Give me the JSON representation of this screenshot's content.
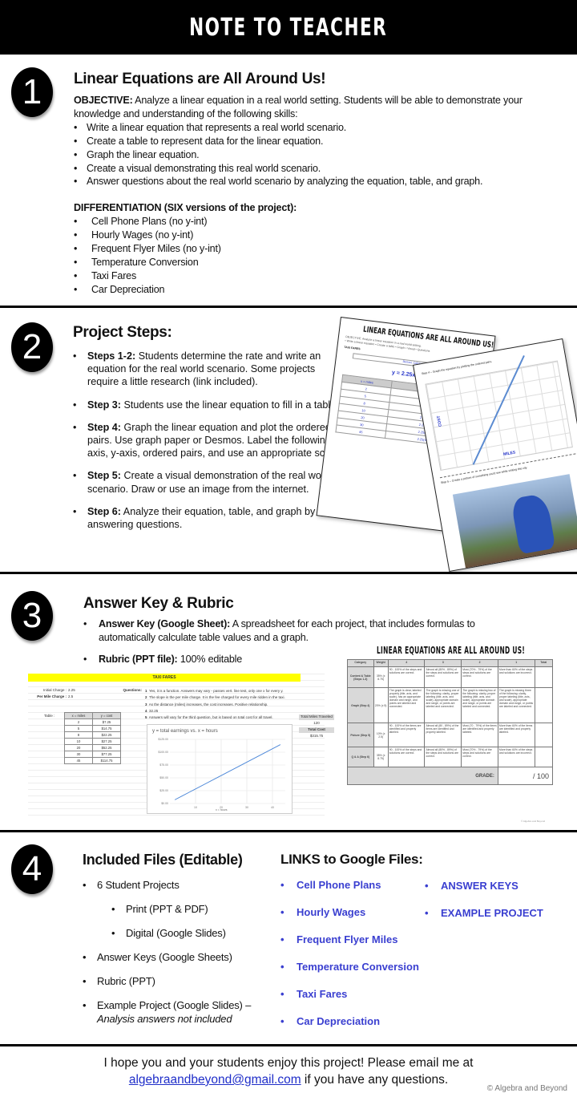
{
  "banner": {
    "title": "NOTE TO TEACHER"
  },
  "section1": {
    "number": "1",
    "title": "Linear Equations are All Around Us!",
    "objective_label": "OBJECTIVE:",
    "objective_text": " Analyze a linear equation in a real world setting. Students will be able to demonstrate your knowledge and understanding of the following skills:",
    "skills": [
      "Write a linear equation that represents a real world scenario.",
      "Create a table to represent data for the linear equation.",
      "Graph the linear equation.",
      "Create a visual demonstrating this real world scenario.",
      "Answer questions about the real world scenario by analyzing the equation, table, and graph."
    ],
    "differentiation_label": "DIFFERENTIATION (SIX versions of the project):",
    "versions": [
      "Cell Phone Plans (no y-int)",
      "Hourly Wages (no y-int)",
      "Frequent Flyer Miles (no y-int)",
      "Temperature Conversion",
      "Taxi Fares",
      "Car Depreciation"
    ]
  },
  "section2": {
    "number": "2",
    "title": "Project Steps:",
    "steps": [
      {
        "label": "Steps 1-2:",
        "text": " Students determine the rate and write an equation for the real world scenario. Some projects require a little research (link included)."
      },
      {
        "label": "Step 3:",
        "text": " Students use the linear equation to fill in a table."
      },
      {
        "label": "Step 4:",
        "text": " Graph the linear equation and plot the ordered pairs. Use graph paper or Desmos. Label the following: x-axis, y-axis, ordered pairs, and use an appropriate scale."
      },
      {
        "label": "Step 5:",
        "text": " Create a visual demonstration of the real world scenario. Draw or use an image from the internet."
      },
      {
        "label": "Step 6:",
        "text": " Analyze their equation, table, and graph by answering questions."
      }
    ],
    "preview": {
      "page1_title": "LINEAR EQUATIONS ARE ALL AROUND US!",
      "page1_subtitle": "TAXI FARES",
      "page1_city": "Denver, Colorado",
      "page1_equation": "y = 2.25x + 2.50",
      "page1_table_header": [
        "x = miles",
        "Linear Equation"
      ],
      "page1_table_rows": [
        [
          "2",
          "2.25(2) + 2.50"
        ],
        [
          "5",
          "2.25(5) + 2.50"
        ],
        [
          "8",
          "2.25(8) + 2.50"
        ],
        [
          "10",
          "2.25(10) + 2.50"
        ],
        [
          "20",
          "2.25(20) + 2.50"
        ],
        [
          "30",
          "2.25(30) + 2.50"
        ],
        [
          "45",
          "2.25(45) + 2.50"
        ]
      ],
      "page2_graph_step": "Step 4 – Graph the equation by plotting the ordered pairs.",
      "page2_xlabel": "MILES",
      "page2_ylabel": "COST",
      "page2_photo_step": "Step 5 – Create a picture of something you'd see while visiting this city."
    }
  },
  "section3": {
    "number": "3",
    "title": "Answer Key & Rubric",
    "items": [
      {
        "label": "Answer Key (Google Sheet):",
        "text": " A spreadsheet for each project, that includes formulas to automatically calculate table values and a graph."
      },
      {
        "label": "Rubric (PPT file):",
        "text": " 100% editable"
      }
    ],
    "sheet": {
      "title": "TAXI FARES",
      "initial_charge_label": "Initial Charge :",
      "initial_charge": "2.25",
      "per_mile_label": "Per Mile Charge :",
      "per_mile": "2.5",
      "table_label": "Table :",
      "table_header": [
        "x = miles",
        "y = cost"
      ],
      "table_rows": [
        [
          "2",
          "$7.25"
        ],
        [
          "5",
          "$14.75"
        ],
        [
          "8",
          "$22.25"
        ],
        [
          "10",
          "$27.25"
        ],
        [
          "20",
          "$52.25"
        ],
        [
          "30",
          "$77.25"
        ],
        [
          "45",
          "$114.75"
        ]
      ],
      "questions_label": "Questions:",
      "answers": [
        {
          "n": "1",
          "text": "Yes, it is a function. Answers may vary - passes vert. line test, only one x for every y."
        },
        {
          "n": "2",
          "text": "The slope is the per mile charge. It is the fee charged for every mile ridden in the taxi."
        },
        {
          "n": "3",
          "text": "As the distance (miles) increases, the cost increases. Positive relationship."
        },
        {
          "n": "4",
          "text": "32.25"
        },
        {
          "n": "5",
          "text": "Answers will vary for the third question, but is based on total cost for all travel."
        }
      ],
      "total_miles_label": "Total Miles Traveled",
      "total_miles": "120",
      "total_cost_label": "Total Cost",
      "total_cost": "$315.75",
      "chart_title": "y = total earnings vs. x = hours",
      "chart_xlabel": "x = hours",
      "chart_ylabel": "y = total earnings",
      "chart_yticks": [
        "$0.00",
        "$25.00",
        "$50.00",
        "$75.00",
        "$100.00",
        "$125.00"
      ],
      "chart_xticks": [
        "10",
        "20",
        "30",
        "40"
      ]
    },
    "rubric": {
      "title": "LINEAR EQUATIONS ARE ALL AROUND US!",
      "headers": [
        "Category",
        "Weight",
        "4",
        "3",
        "2",
        "1",
        "Total"
      ],
      "rows": [
        {
          "category": "Content & Table (Steps 1-3)",
          "weight": "35% (x 8.75)",
          "c4": "90 - 100% of the steps and solutions are correct.",
          "c3": "Almost all (80% - 89%) of the steps and solutions are correct.",
          "c2": "Most (70% - 79%) of the steps and solutions are correct.",
          "c1": "More than 60% of the steps and solutions are incorrect."
        },
        {
          "category": "Graph (Step 4)",
          "weight": "20% (x 5)",
          "c4": "The graph is clear, labeled properly (title, axis, and scale), has an appropriate domain and range, and points are labeled and connected.",
          "c3": "The graph is missing one of the following: clarity, proper labeling (title, axis, and scale), appropriate domain and range, or points are labeled and connected.",
          "c2": "The graph is missing two of the following: clarity, proper labeling (title, axis, and scale), appropriate domain and range, or points are labeled and connected.",
          "c1": "The graph is missing three of the following: clarity, proper labeling (title, axis, and scale), appropriate domain and range, or points are labeled and connected."
        },
        {
          "category": "Picture (Step 5)",
          "weight": "10% (x 2.5)",
          "c4": "90 - 100% of the items are identified and properly labeled.",
          "c3": "Almost all (80 - 89%) of the items are identified and properly labeled.",
          "c2": "Most (70 - 79%) of the items are identified and properly labeled.",
          "c1": "More than 60% of the items are identified and properly labeled."
        },
        {
          "category": "Q & A (Step 6)",
          "weight": "35% (x 8.75)",
          "c4": "90 - 100% of the steps and solutions are correct.",
          "c3": "Almost all (80% - 89%) of the steps and solutions are correct.",
          "c2": "Most (70% - 79%) of the steps and solutions are correct.",
          "c1": "More than 60% of the steps and solutions are incorrect."
        }
      ],
      "grade_label": "GRADE:",
      "grade_value": "/ 100",
      "copyright": "© Algebra and Beyond"
    }
  },
  "section4": {
    "number": "4",
    "title": "Included Files (Editable)",
    "files": [
      {
        "text": "6 Student Projects",
        "level": 1
      },
      {
        "text": "Print (PPT & PDF)",
        "level": 2
      },
      {
        "text": "Digital (Google Slides)",
        "level": 2
      },
      {
        "text": "Answer Keys (Google Sheets)",
        "level": 1
      },
      {
        "text": "Rubric (PPT)",
        "level": 1
      }
    ],
    "example_project": "Example Project (Google Slides) –",
    "example_note": "Analysis answers not included",
    "links_title": "LINKS to Google Files:",
    "links_left": [
      "Cell Phone Plans",
      "Hourly Wages",
      "Frequent Flyer Miles",
      "Temperature Conversion",
      "Taxi Fares",
      "Car Depreciation"
    ],
    "links_right": [
      "ANSWER KEYS",
      "EXAMPLE PROJECT"
    ],
    "link_color": "#3a3fd0"
  },
  "footer": {
    "line1": "I hope you and your students enjoy this project! Please email me at",
    "email": "algebraandbeyond@gmail.com",
    "line2_rest": " if you have any questions.",
    "copyright": "© Algebra and Beyond"
  }
}
